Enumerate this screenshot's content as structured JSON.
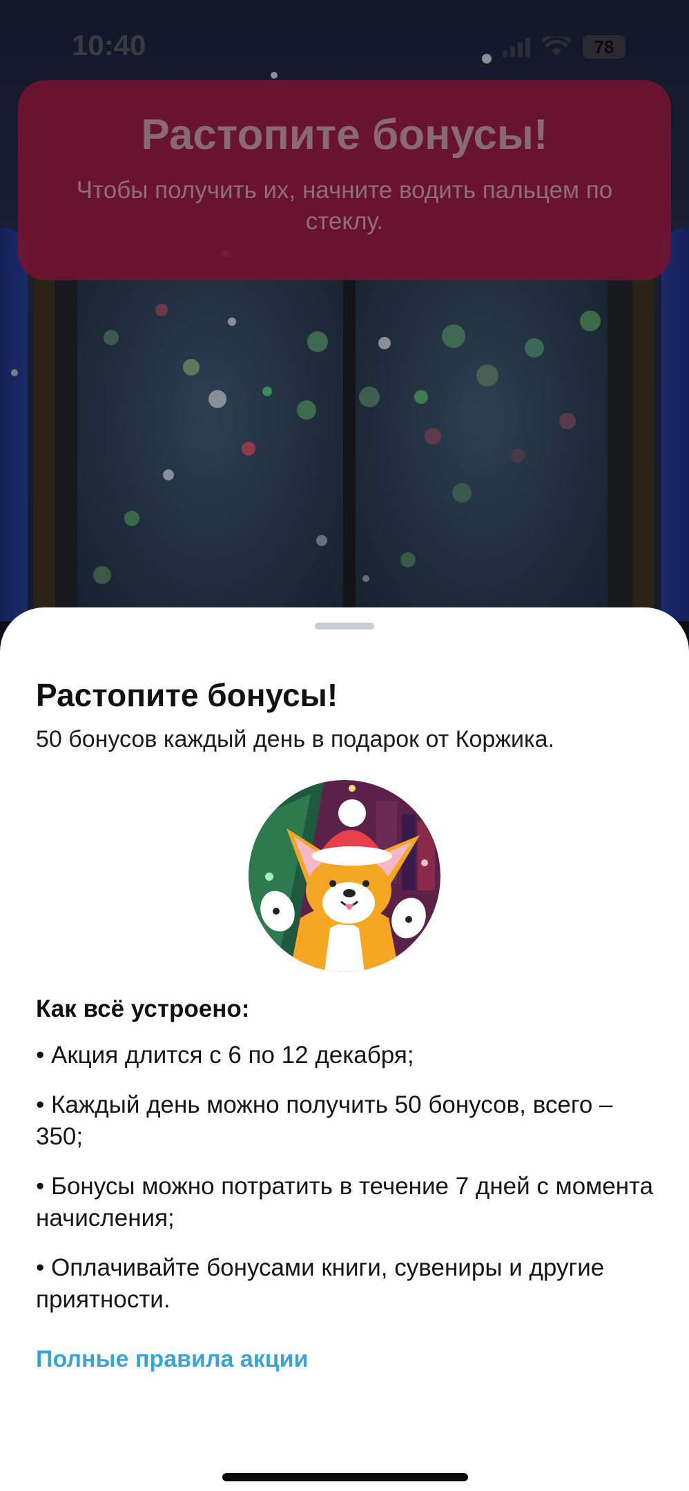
{
  "status_bar": {
    "time": "10:40",
    "battery": "78"
  },
  "banner": {
    "title": "Растопите бонусы!",
    "subtitle": "Чтобы получить их, начните водить пальцем по стеклу."
  },
  "sheet": {
    "title": "Растопите бонусы!",
    "subtitle": "50 бонусов каждый день в подарок от Коржика.",
    "how_title": "Как всё устроено:",
    "rules": [
      "• Акция длится с 6 по 12 декабря;",
      "• Каждый день можно получить 50 бонусов, всего – 350;",
      "• Бонусы можно потратить в течение 7 дней с момента начисления;",
      "• Оплачивайте бонусами книги, сувениры и другие приятности."
    ],
    "link_label": "Полные правила акции"
  },
  "colors": {
    "banner_bg": "#741230",
    "link": "#3aa3d8",
    "corgi_orange": "#f5a623",
    "hat_red": "#e8404a"
  }
}
